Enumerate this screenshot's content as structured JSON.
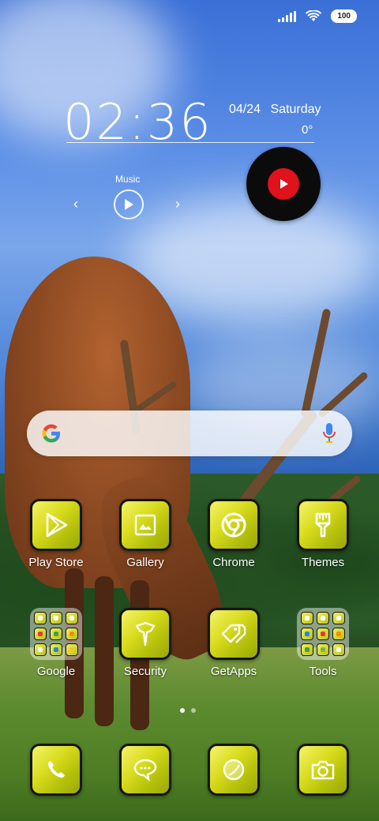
{
  "status_bar": {
    "battery": "100"
  },
  "clock_widget": {
    "time": "02:36",
    "date": "04/24",
    "weekday": "Saturday",
    "temperature": "0°"
  },
  "music_widget": {
    "label": "Music"
  },
  "search_bar": {},
  "apps_row1": [
    {
      "label": "Play Store",
      "icon": "play-store-icon"
    },
    {
      "label": "Gallery",
      "icon": "gallery-icon"
    },
    {
      "label": "Chrome",
      "icon": "chrome-icon"
    },
    {
      "label": "Themes",
      "icon": "themes-brush-icon"
    }
  ],
  "apps_row2": [
    {
      "label": "Google",
      "icon": "google-folder"
    },
    {
      "label": "Security",
      "icon": "security-icon"
    },
    {
      "label": "GetApps",
      "icon": "getapps-icon"
    },
    {
      "label": "Tools",
      "icon": "tools-folder"
    }
  ],
  "dock": [
    {
      "icon": "phone-icon"
    },
    {
      "icon": "messaging-icon"
    },
    {
      "icon": "browser-icon"
    },
    {
      "icon": "camera-icon"
    }
  ],
  "page_indicator": {
    "pages": 2,
    "active": 1
  },
  "colors": {
    "tile_yellow": "#d9dc1e",
    "tile_border": "#151515",
    "youtube_red": "#e0121b"
  }
}
